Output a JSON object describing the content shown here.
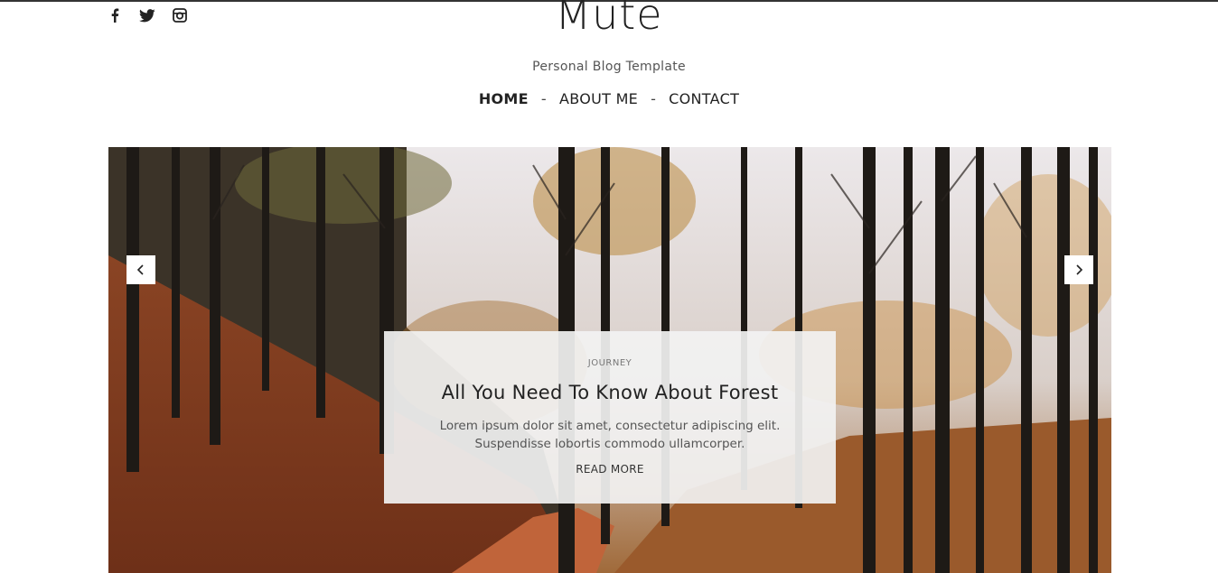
{
  "social": {
    "icons": [
      "facebook-icon",
      "twitter-icon",
      "instagram-icon"
    ]
  },
  "brand": {
    "title": "Mute",
    "subtitle": "Personal Blog Template"
  },
  "nav": {
    "items": [
      {
        "label": "HOME",
        "active": true
      },
      {
        "label": "ABOUT ME",
        "active": false
      },
      {
        "label": "CONTACT",
        "active": false
      }
    ],
    "separator": "-"
  },
  "slider": {
    "prev_icon": "chevron-left-icon",
    "next_icon": "chevron-right-icon",
    "slide": {
      "category": "JOURNEY",
      "title": "All You Need To Know About Forest",
      "excerpt": "Lorem ipsum dolor sit amet, consectetur adipiscing elit. Suspendisse lobortis commodo ullamcorper.",
      "read_more": "READ MORE"
    }
  },
  "colors": {
    "text": "#222222",
    "card_bg": "#f2f2f2",
    "foliage": "#b86a2a"
  }
}
